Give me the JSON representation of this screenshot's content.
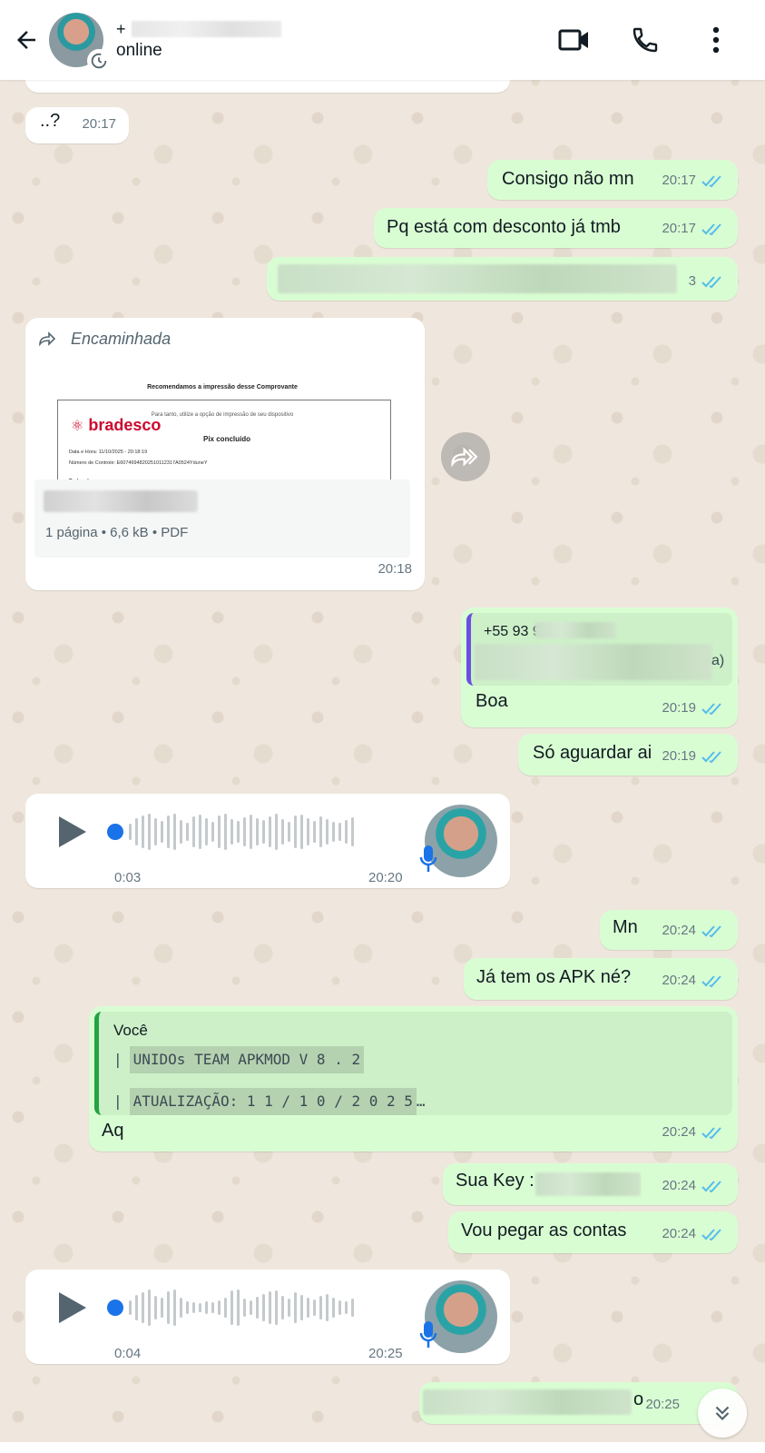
{
  "header": {
    "contact_status": "online",
    "name_prefix": "+"
  },
  "messages": [
    {
      "text": "..?",
      "time": "20:17"
    },
    {
      "text": "Consigo não mn",
      "time": "20:17"
    },
    {
      "text": "Pq está com desconto já tmb",
      "time": "20:17"
    },
    {
      "time_partial": "3"
    },
    {
      "forwarded_label": "Encaminhada",
      "doc_header": "Recomendamos a impressão desse Comprovante",
      "doc_subheader": "Para tanto, utilize a opção de impressão de seu dispositivo",
      "doc_brand": "bradesco",
      "doc_status": "Pix concluído",
      "doc_line1": "Data e Hora:  11/10/2025 - 20:18:19",
      "doc_line2": "Número de Controle:  E60746948202510112317A0524YduneY",
      "doc_line3": "Dados de quem pagou",
      "doc_info": "1 página • 6,6 kB • PDF",
      "time": "20:18"
    },
    {
      "quote_number": "+55 93 9",
      "quote_tail": "a)",
      "text": "Boa",
      "time": "20:19"
    },
    {
      "text": "Só aguardar ai",
      "time": "20:19"
    },
    {
      "duration": "0:03",
      "time": "20:20"
    },
    {
      "text": "Mn",
      "time": "20:24"
    },
    {
      "text": "Já tem os APK né?",
      "time": "20:24"
    },
    {
      "quote_author": "Você",
      "quote_line1": "UNIDOs TEAM APKMOD V 8 . 2",
      "quote_line2": "ATUALIZAÇÃO: 1 1 / 1 0 / 2 0 2 5",
      "text": "Aq",
      "time": "20:24"
    },
    {
      "text": "Sua Key :",
      "time": "20:24"
    },
    {
      "text": "Vou pegar as contas",
      "time": "20:24"
    },
    {
      "duration": "0:04",
      "time": "20:25"
    },
    {
      "tail": "o",
      "time": "20:25"
    }
  ],
  "colors": {
    "incoming_bubble": "#ffffff",
    "outgoing_bubble": "#d9fdd3",
    "read_ticks": "#53bdeb",
    "voice_progress": "#1a73e8",
    "quote_bar_contact": "#6b4fe0",
    "quote_bar_self": "#25a244"
  },
  "icons": [
    "back-arrow-icon",
    "disappearing-timer-icon",
    "video-call-icon",
    "phone-icon",
    "more-options-icon",
    "forward-icon",
    "play-icon",
    "mic-icon",
    "double-check-icon",
    "scroll-down-icon"
  ]
}
